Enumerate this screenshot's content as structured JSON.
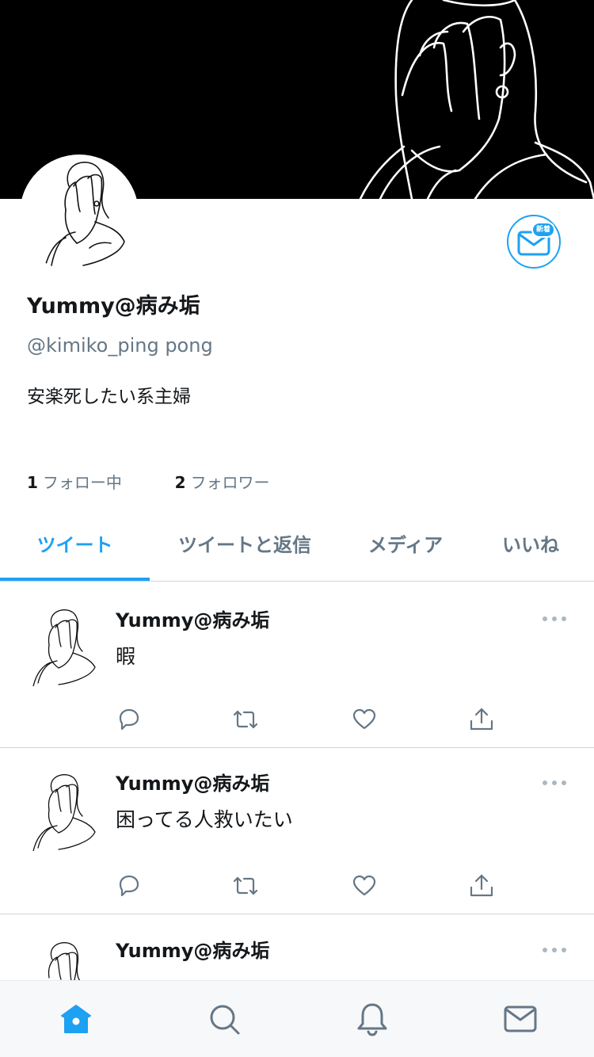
{
  "profile": {
    "display_name": "Yummy@病み垢",
    "handle": "@kimiko_ping pong",
    "bio": "安楽死したい系主婦",
    "following_count": "1",
    "following_label": "フォロー中",
    "followers_count": "2",
    "followers_label": "フォロワー",
    "new_badge": "新着"
  },
  "tabs": [
    {
      "label": "ツイート",
      "active": true
    },
    {
      "label": "ツイートと返信",
      "active": false
    },
    {
      "label": "メディア",
      "active": false
    },
    {
      "label": "いいね",
      "active": false
    }
  ],
  "tweets": [
    {
      "author": "Yummy@病み垢",
      "text": "暇"
    },
    {
      "author": "Yummy@病み垢",
      "text": "困ってる人救いたい"
    },
    {
      "author": "Yummy@病み垢",
      "text": ""
    }
  ],
  "bottom_nav": [
    {
      "icon": "home-icon"
    },
    {
      "icon": "search-icon"
    },
    {
      "icon": "bell-icon"
    },
    {
      "icon": "mail-icon"
    }
  ],
  "colors": {
    "accent": "#1da1f2",
    "secondary_text": "#657786",
    "divider": "#ccd6dd",
    "icon_gray": "#657786"
  }
}
